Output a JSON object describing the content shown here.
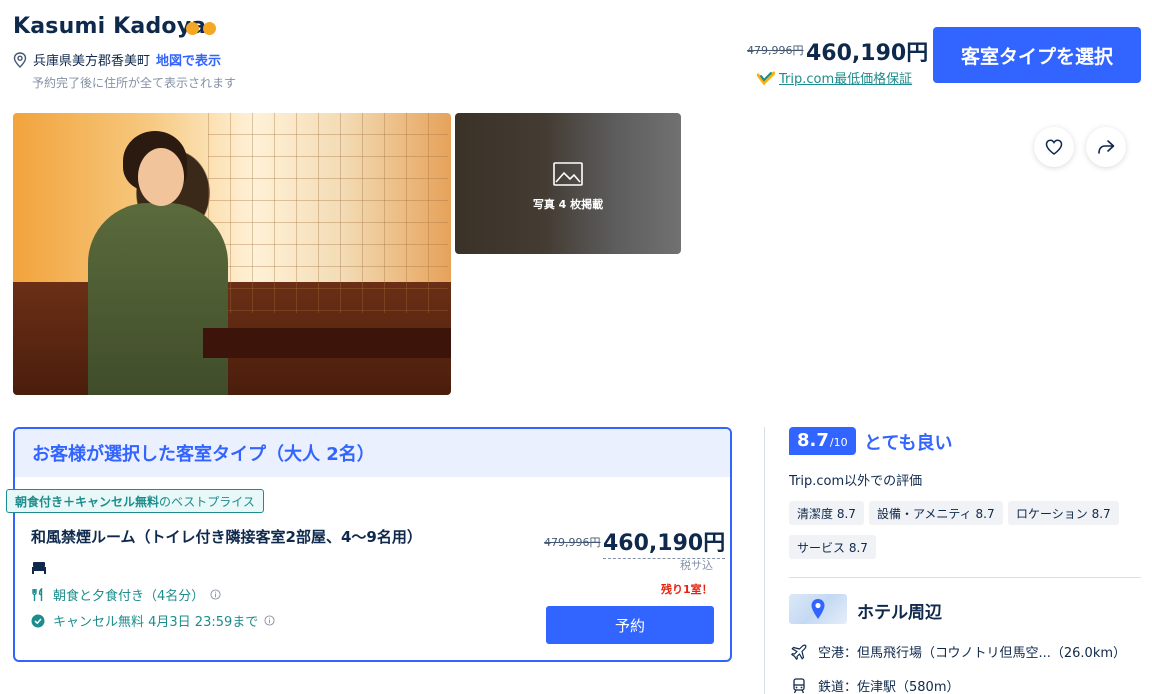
{
  "header": {
    "hotel_name": "Kasumi Kadoya",
    "address": "兵庫県美方郡香美町",
    "map_link": "地図で表示",
    "address_note": "予約完了後に住所が全て表示されます",
    "old_price": "479,996円",
    "new_price": "460,190円",
    "guarantee": "Trip.com最低価格保証",
    "select_button": "客室タイプを選択"
  },
  "gallery": {
    "photo_count": "写真 4 枚掲載"
  },
  "room_card": {
    "title": "お客様が選択した客室タイプ（大人 2名）",
    "best_tag_bold": "朝食付き＋キャンセル無料",
    "best_tag_rest": "のベストプライス",
    "room_name": "和風禁煙ルーム（トイレ付き隣接客室2部屋、4〜9名用）",
    "meal": "朝食と夕食付き（4名分）",
    "cancel": "キャンセル無料 4月3日 23:59まで",
    "old_price": "479,996円",
    "new_price": "460,190円",
    "tax_note": "税サ込",
    "remaining": "残り1室！",
    "book_button": "予約"
  },
  "rating": {
    "score": "8.7",
    "max": "/10",
    "label": "とても良い",
    "note": "Trip.com以外での評価",
    "categories": [
      {
        "label": "清潔度 8.7"
      },
      {
        "label": "設備・アメニティ 8.7"
      },
      {
        "label": "ロケーション 8.7"
      },
      {
        "label": "サービス 8.7"
      }
    ]
  },
  "nearby": {
    "title": "ホテル周辺",
    "items": [
      {
        "icon": "plane-icon",
        "label": "空港：但馬飛行場（コウノトリ但馬空...（26.0km）"
      },
      {
        "icon": "train-icon",
        "label": "鉄道：佐津駅（580m）"
      }
    ]
  },
  "colors": {
    "primary": "#3264ff",
    "teal": "#1c8d8c",
    "star": "#f5a623",
    "alert": "#e8220f"
  }
}
